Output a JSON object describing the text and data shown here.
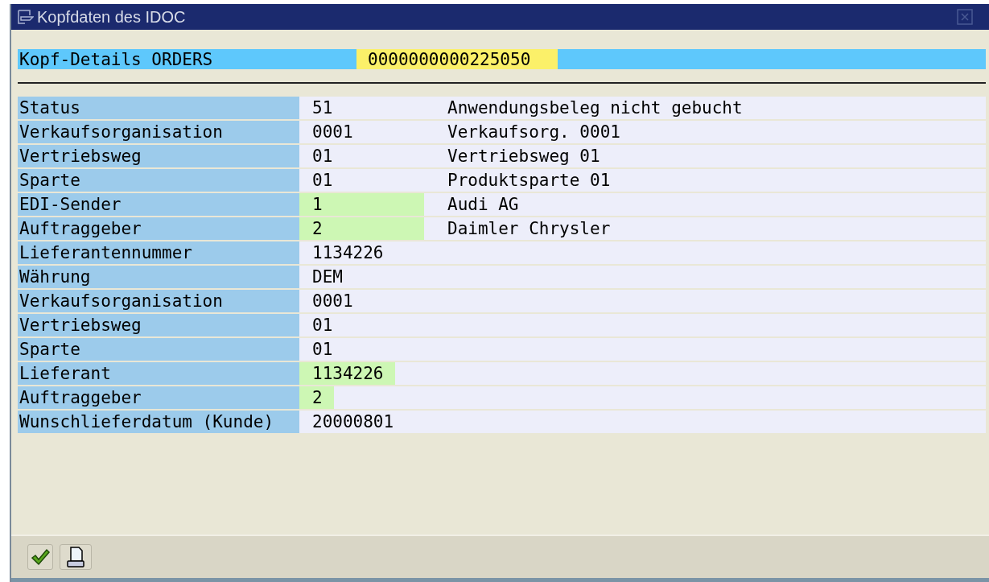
{
  "window": {
    "title": "Kopfdaten des IDOC"
  },
  "header": {
    "label": "Kopf-Details ORDERS",
    "value": "0000000000225050"
  },
  "rows": [
    {
      "label": "Status",
      "value": "51",
      "description": "Anwendungsbeleg nicht gebucht",
      "highlighted": false
    },
    {
      "label": "Verkaufsorganisation",
      "value": "0001",
      "description": "Verkaufsorg. 0001",
      "highlighted": false
    },
    {
      "label": "Vertriebsweg",
      "value": "01",
      "description": "Vertriebsweg 01",
      "highlighted": false
    },
    {
      "label": "Sparte",
      "value": "01",
      "description": "Produktsparte 01",
      "highlighted": false
    },
    {
      "label": "EDI-Sender",
      "value": "1",
      "description": "Audi AG",
      "highlighted": true
    },
    {
      "label": "Auftraggeber",
      "value": "2",
      "description": "Daimler Chrysler",
      "highlighted": true
    },
    {
      "label": "Lieferantennummer",
      "value": "1134226",
      "highlighted": false
    },
    {
      "label": "Währung",
      "value": "DEM",
      "highlighted": false
    },
    {
      "label": "Verkaufsorganisation",
      "value": "0001",
      "highlighted": false
    },
    {
      "label": "Vertriebsweg",
      "value": "01",
      "highlighted": false
    },
    {
      "label": "Sparte",
      "value": "01",
      "highlighted": false
    },
    {
      "label": "Lieferant",
      "value": "1134226",
      "highlighted": true
    },
    {
      "label": "Auftraggeber",
      "value": "2",
      "highlighted": true
    },
    {
      "label": "Wunschlieferdatum (Kunde)",
      "value": "20000801",
      "highlighted": false
    }
  ],
  "toolbar": [
    {
      "kind": "confirm"
    },
    {
      "kind": "print"
    }
  ]
}
